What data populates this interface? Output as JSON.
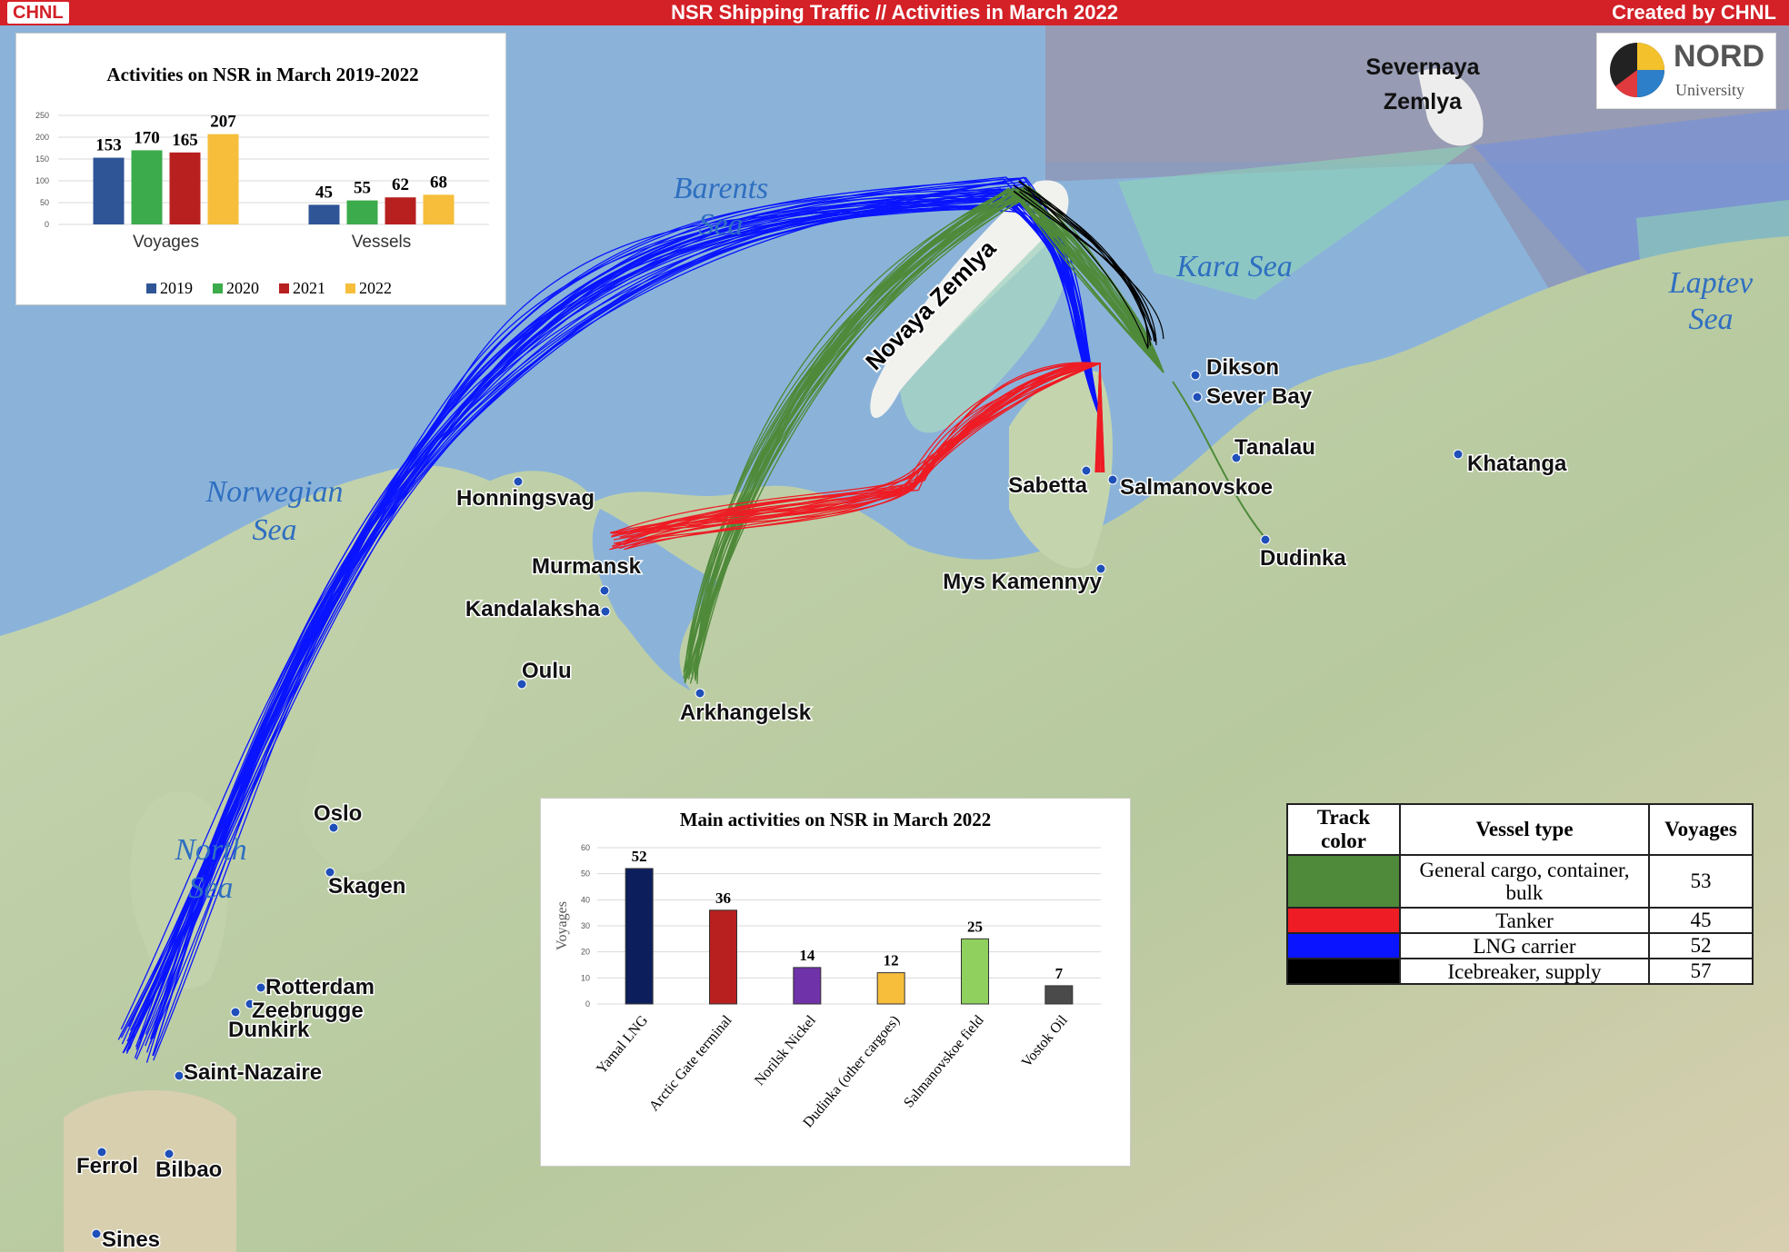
{
  "header": {
    "logo": "CHNL",
    "title": "NSR Shipping Traffic // Activities in March 2022",
    "credit": "Created by CHNL"
  },
  "nord_logo": {
    "name": "NORD",
    "sub": "University"
  },
  "sea_labels": [
    {
      "id": "barents",
      "lines": [
        "Barents",
        "Sea"
      ]
    },
    {
      "id": "norwegian",
      "lines": [
        "Norwegian",
        "Sea"
      ]
    },
    {
      "id": "kara",
      "lines": [
        "Kara Sea"
      ]
    },
    {
      "id": "laptev",
      "lines": [
        "Laptev",
        "Sea"
      ]
    },
    {
      "id": "north",
      "lines": [
        "North",
        "Sea"
      ]
    }
  ],
  "land_labels": {
    "severnaya": [
      "Severnaya",
      "Zemlya"
    ],
    "novaya": "Novaya Zemlya"
  },
  "places": [
    "Dikson",
    "Sever Bay",
    "Tanalau",
    "Khatanga",
    "Sabetta",
    "Salmanovskoe",
    "Dudinka",
    "Mys Kamennyy",
    "Honningsvag",
    "Murmansk",
    "Kandalaksha",
    "Oulu",
    "Arkhangelsk",
    "Oslo",
    "Skagen",
    "Rotterdam",
    "Zeebrugge",
    "Dunkirk",
    "Saint-Nazaire",
    "Ferrol",
    "Bilbao",
    "Sines"
  ],
  "chart_data": [
    {
      "type": "bar",
      "title": "Activities on NSR in March 2019-2022",
      "categories": [
        "Voyages",
        "Vessels"
      ],
      "series": [
        {
          "name": "2019",
          "values": [
            153,
            45
          ],
          "color": "#2f5597"
        },
        {
          "name": "2020",
          "values": [
            170,
            55
          ],
          "color": "#3cab4b"
        },
        {
          "name": "2021",
          "values": [
            165,
            62
          ],
          "color": "#b7201f"
        },
        {
          "name": "2022",
          "values": [
            207,
            68
          ],
          "color": "#f6be3b"
        }
      ],
      "ylim": [
        0,
        250
      ],
      "yticks": [
        "0",
        "50",
        "100",
        "150",
        "200",
        "250"
      ],
      "legend": "bottom",
      "grid": true
    },
    {
      "type": "bar",
      "title": "Main activities on NSR in March 2022",
      "categories": [
        "Yamal LNG",
        "Arctic Gate terminal",
        "Norilsk Nickel",
        "Dudinka (other cargoes)",
        "Salmanovskoe field",
        "Vostok Oil"
      ],
      "values": [
        52,
        36,
        14,
        12,
        25,
        7
      ],
      "colors": [
        "#0c1f5c",
        "#b7201f",
        "#6f32a8",
        "#f6be3b",
        "#8fd05e",
        "#4a4a4a"
      ],
      "ylabel": "Voyages",
      "ylim": [
        0,
        60
      ],
      "yticks": [
        "0",
        "10",
        "20",
        "30",
        "40",
        "50",
        "60"
      ],
      "grid": true
    }
  ],
  "legend_table": {
    "headers": [
      "Track color",
      "Vessel type",
      "Voyages"
    ],
    "rows": [
      {
        "color": "#4f8a3a",
        "type": "General cargo, container, bulk",
        "voyages": "53"
      },
      {
        "color": "#ee1c24",
        "type": "Tanker",
        "voyages": "45"
      },
      {
        "color": "#0a14ff",
        "type": "LNG carrier",
        "voyages": "52"
      },
      {
        "color": "#000000",
        "type": "Icebreaker, supply",
        "voyages": "57"
      }
    ]
  }
}
